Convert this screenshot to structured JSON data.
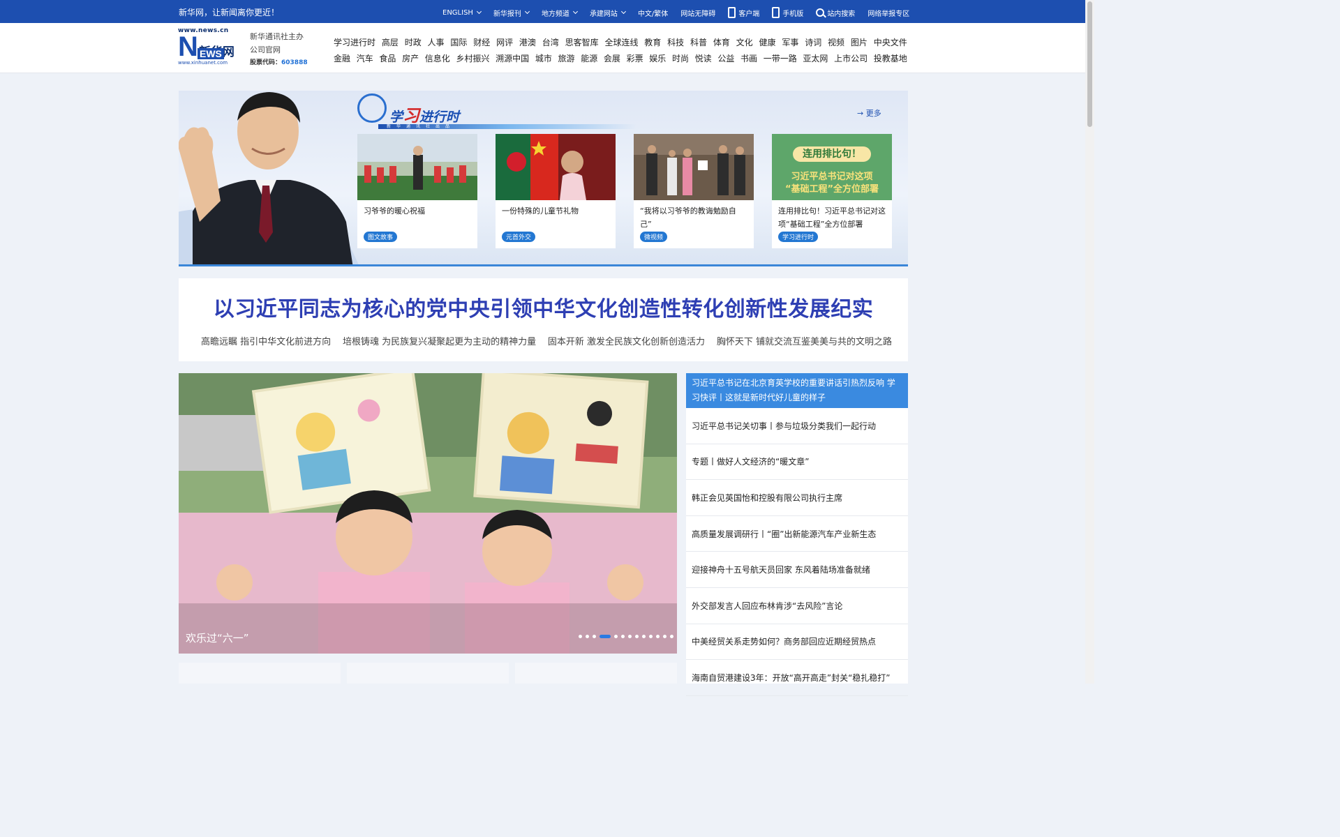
{
  "topbar": {
    "slogan": "新华网，让新闻离你更近！",
    "english": "ENGLISH",
    "publications": "新华报刊",
    "local": "地方频道",
    "hosted": "承建网站",
    "traditional": "中文/繁体",
    "accessible": "网站无障碍",
    "client": "客户端",
    "mobile": "手机版",
    "search": "站内搜索",
    "report": "网络举报专区"
  },
  "header": {
    "logo_url": "www.news.cn",
    "logo_cn": "新华网",
    "logo_n": "N",
    "logo_ews": "EWS",
    "logo_sub": "www.xinhuanet.com",
    "about_line1": "新华通讯社主办",
    "about_line2": "公司官网",
    "stock_label": "股票代码：",
    "stock_code": "603888"
  },
  "nav": {
    "row1": [
      "学习进行时",
      "高层",
      "时政",
      "人事",
      "国际",
      "财经",
      "网评",
      "港澳",
      "台湾",
      "思客智库",
      "全球连线",
      "教育",
      "科技",
      "科普",
      "体育",
      "文化",
      "健康",
      "军事",
      "诗词",
      "视频",
      "图片",
      "中央文件"
    ],
    "row2": [
      "金融",
      "汽车",
      "食品",
      "房产",
      "信息化",
      "乡村振兴",
      "溯源中国",
      "城市",
      "旅游",
      "能源",
      "会展",
      "彩票",
      "娱乐",
      "时尚",
      "悦读",
      "公益",
      "书画",
      "一带一路",
      "亚太网",
      "上市公司",
      "投教基地"
    ]
  },
  "banner": {
    "brand_title": "学习进行时",
    "brand_title_a": "学",
    "brand_title_b": "习",
    "brand_title_c": "进行时",
    "brand_bar": "新华通讯社出品",
    "more": "更多",
    "cards": [
      {
        "title": "习爷爷的暖心祝福",
        "tag": "图文故事"
      },
      {
        "title": "一份特殊的儿童节礼物",
        "tag": "元首外交"
      },
      {
        "title": "“我将以习爷爷的教诲勉励自己”",
        "tag": "微视频"
      },
      {
        "title": "连用排比句！习近平总书记对这项“基础工程”全方位部署",
        "tag": "学习进行时",
        "poster_line1": "连用排比句！",
        "poster_line2": "习近平总书记对这项",
        "poster_line3": "“基础工程”全方位部署"
      }
    ]
  },
  "headline": {
    "title": "以习近平同志为核心的党中央引领中华文化创造性转化创新性发展纪实",
    "subs": [
      "高瞻远瞩 指引中华文化前进方向",
      "培根铸魂 为民族复兴凝聚起更为主动的精神力量",
      "固本开新 激发全民族文化创新创造活力",
      "胸怀天下 铺就交流互鉴美美与共的文明之路"
    ]
  },
  "photo": {
    "caption": "欢乐过“六一”",
    "slide_count": 13,
    "active_slide": 3
  },
  "news_list": {
    "top": "习近平总书记在北京育英学校的重要讲话引热烈反响 学习快评丨这就是新时代好儿童的样子",
    "items": [
      "习近平总书记关切事丨参与垃圾分类我们一起行动",
      "专题丨做好人文经济的“暖文章”",
      "韩正会见英国怡和控股有限公司执行主席",
      "高质量发展调研行丨“圈”出新能源汽车产业新生态",
      "迎接神舟十五号航天员回家 东风着陆场准备就绪",
      "外交部发言人回应布林肯涉“去风险”言论",
      "中美经贸关系走势如何？商务部回应近期经贸热点",
      "海南自贸港建设3年：开放“高开高走”封关“稳扎稳打”"
    ]
  },
  "colors": {
    "brand_blue": "#1d4fb0",
    "headline_blue": "#2e3fb3",
    "accent_blue": "#3a8ae0",
    "tag_blue": "#2377d2"
  }
}
